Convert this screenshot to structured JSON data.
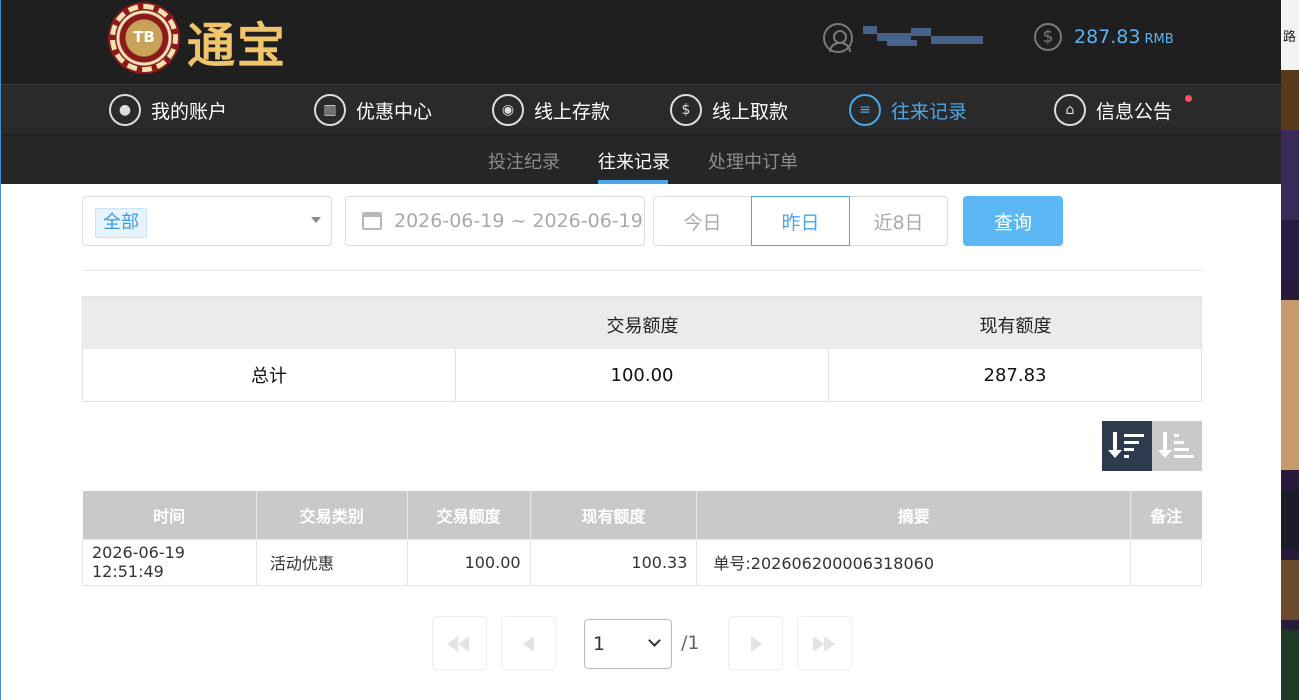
{
  "header": {
    "logo_badge": "TB",
    "logo_text": "通宝",
    "balance": "287.83",
    "currency": "RMB"
  },
  "nav": [
    {
      "label": "我的账户",
      "icon": "user-icon"
    },
    {
      "label": "优惠中心",
      "icon": "gift-icon"
    },
    {
      "label": "线上存款",
      "icon": "deposit-icon"
    },
    {
      "label": "线上取款",
      "icon": "withdraw-icon"
    },
    {
      "label": "往来记录",
      "icon": "records-icon",
      "active": true
    },
    {
      "label": "信息公告",
      "icon": "bell-icon",
      "has_notification": true
    }
  ],
  "subnav": [
    {
      "label": "投注纪录"
    },
    {
      "label": "往来记录",
      "active": true
    },
    {
      "label": "处理中订单"
    }
  ],
  "filters": {
    "type_selected": "全部",
    "date_range": "2026-06-19 ~ 2026-06-19",
    "quick_ranges": [
      "今日",
      "昨日",
      "近8日"
    ],
    "quick_active": "昨日",
    "query_label": "查询"
  },
  "summary": {
    "headers": [
      "",
      "交易额度",
      "现有额度"
    ],
    "total_label": "总计",
    "total_amount": "100.00",
    "current_amount": "287.83"
  },
  "table": {
    "headers": [
      "时间",
      "交易类别",
      "交易额度",
      "现有额度",
      "摘要",
      "备注"
    ],
    "rows": [
      {
        "time": "2026-06-19 12:51:49",
        "type": "活动优惠",
        "amount": "100.00",
        "balance": "100.33",
        "summary": "单号:202606200006318060",
        "note": ""
      }
    ]
  },
  "pager": {
    "current": "1",
    "total": "/1"
  },
  "side_strip": {
    "text": "路"
  },
  "colors": {
    "accent": "#4aa7e8",
    "header_bg": "#1f1f1f",
    "nav_bg": "#2a2a2a",
    "query_button": "#5bb8f5",
    "logo_gold": "#f0c56a",
    "notification_dot": "#ff4d6a"
  }
}
